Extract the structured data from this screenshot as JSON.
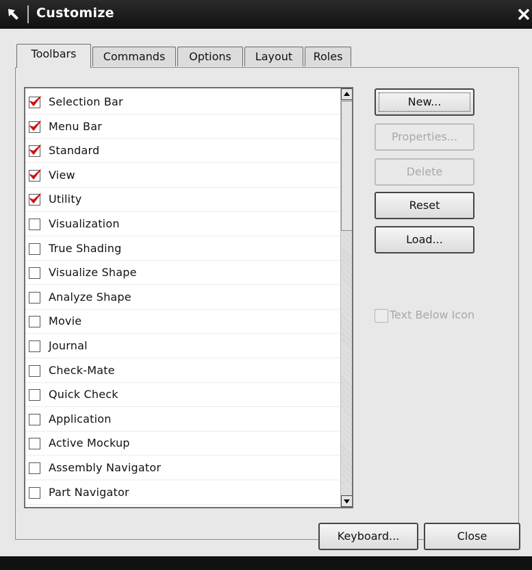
{
  "window": {
    "title": "Customize"
  },
  "tabs": [
    {
      "label": "Toolbars",
      "active": true
    },
    {
      "label": "Commands",
      "active": false
    },
    {
      "label": "Options",
      "active": false
    },
    {
      "label": "Layout",
      "active": false
    },
    {
      "label": "Roles",
      "active": false
    }
  ],
  "toolbar_list": {
    "items": [
      {
        "label": "Selection Bar",
        "checked": true
      },
      {
        "label": "Menu Bar",
        "checked": true
      },
      {
        "label": "Standard",
        "checked": true
      },
      {
        "label": "View",
        "checked": true
      },
      {
        "label": "Utility",
        "checked": true
      },
      {
        "label": "Visualization",
        "checked": false
      },
      {
        "label": "True Shading",
        "checked": false
      },
      {
        "label": "Visualize Shape",
        "checked": false
      },
      {
        "label": "Analyze Shape",
        "checked": false
      },
      {
        "label": "Movie",
        "checked": false
      },
      {
        "label": "Journal",
        "checked": false
      },
      {
        "label": "Check-Mate",
        "checked": false
      },
      {
        "label": "Quick Check",
        "checked": false
      },
      {
        "label": "Application",
        "checked": false
      },
      {
        "label": "Active Mockup",
        "checked": false
      },
      {
        "label": "Assembly Navigator",
        "checked": false
      },
      {
        "label": "Part Navigator",
        "checked": false
      }
    ]
  },
  "side_buttons": {
    "new": "New...",
    "properties": "Properties...",
    "delete": "Delete",
    "reset": "Reset",
    "load": "Load..."
  },
  "text_below_icon": {
    "label": "Text Below Icon",
    "checked": false,
    "enabled": false
  },
  "footer": {
    "keyboard": "Keyboard...",
    "close": "Close"
  },
  "colors": {
    "titlebar": "#1a1a1a",
    "check": "#d01010",
    "dialog_bg": "#e8e8e8"
  }
}
